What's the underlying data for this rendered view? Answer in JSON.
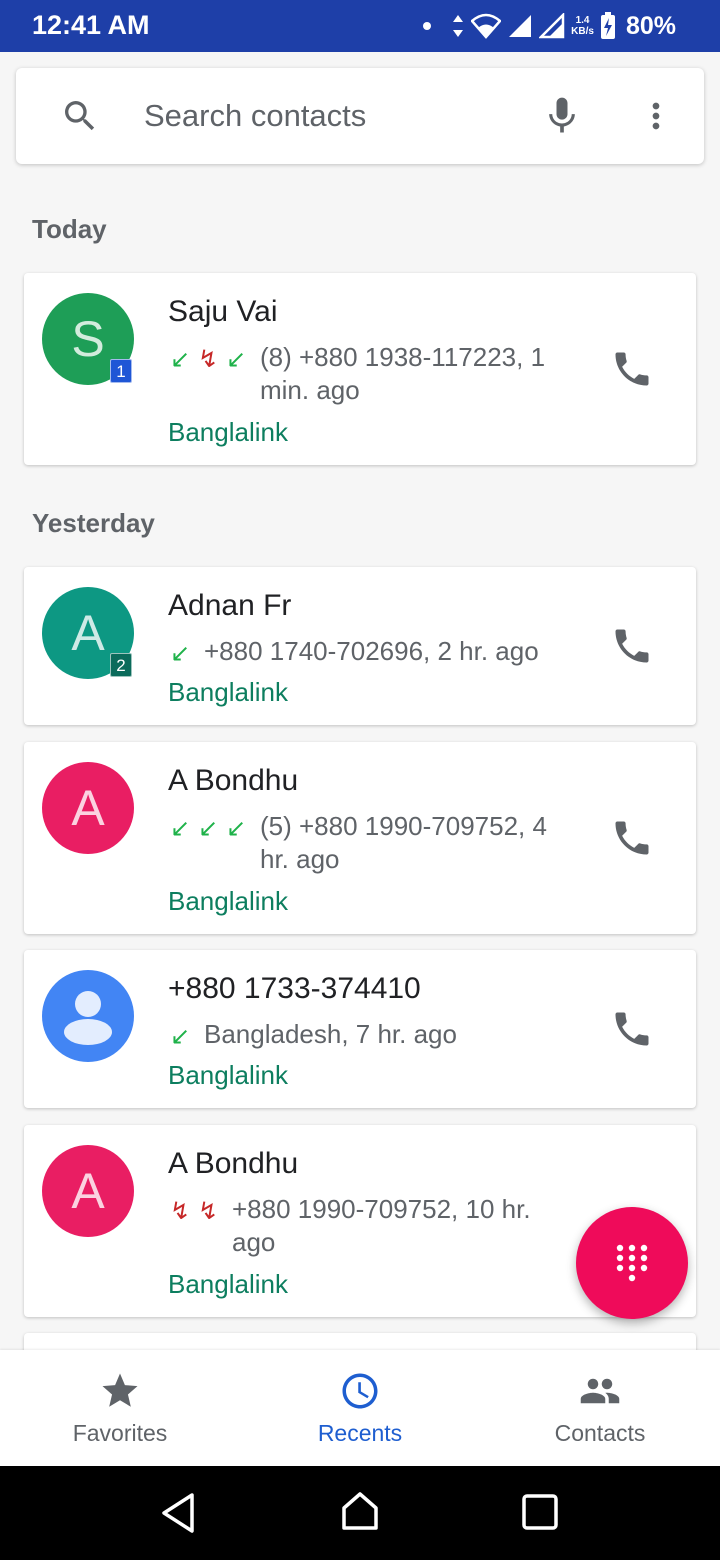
{
  "status_bar": {
    "time": "12:41 AM",
    "speed_value": "1.4",
    "speed_unit": "KB/s",
    "battery": "80%"
  },
  "search": {
    "placeholder": "Search contacts"
  },
  "sections": {
    "today": "Today",
    "yesterday": "Yesterday"
  },
  "calls": [
    {
      "initial": "S",
      "avatar_color": "#1e9e57",
      "badge": "1",
      "badge_color": "#1f56d6",
      "name": "Saju Vai",
      "arrows": [
        "incoming",
        "missed",
        "incoming"
      ],
      "detail": "(8) +880 1938-117223, 1 min. ago",
      "sim": "Banglalink"
    },
    {
      "initial": "A",
      "avatar_color": "#0d9883",
      "badge": "2",
      "badge_color": "#0b6b5b",
      "name": "Adnan Fr",
      "arrows": [
        "incoming"
      ],
      "detail": "+880 1740-702696, 2 hr. ago",
      "sim": "Banglalink"
    },
    {
      "initial": "A",
      "avatar_color": "#e91e63",
      "badge": "",
      "name": "A Bondhu",
      "arrows": [
        "incoming",
        "incoming",
        "incoming"
      ],
      "detail": "(5) +880 1990-709752, 4 hr. ago",
      "sim": "Banglalink"
    },
    {
      "initial": "",
      "avatar_color": "#4285f4",
      "badge": "",
      "name": "+880 1733-374410",
      "arrows": [
        "incoming"
      ],
      "detail": "Bangladesh, 7 hr. ago",
      "sim": "Banglalink"
    },
    {
      "initial": "A",
      "avatar_color": "#e91e63",
      "badge": "",
      "name": "A Bondhu",
      "arrows": [
        "missed",
        "missed"
      ],
      "detail": "+880 1990-709752, 10 hr. ago",
      "sim": "Banglalink"
    }
  ],
  "bottom_nav": {
    "favorites": "Favorites",
    "recents": "Recents",
    "contacts": "Contacts"
  },
  "colors": {
    "accent": "#1e5ed0",
    "fab": "#ef0b5a",
    "status_bar": "#1e3fa8",
    "sim_text": "#0d7e5f"
  },
  "icons": [
    "search-icon",
    "mic-icon",
    "more-vert-icon",
    "phone-icon",
    "dialpad-icon",
    "star-icon",
    "clock-icon",
    "people-icon"
  ]
}
